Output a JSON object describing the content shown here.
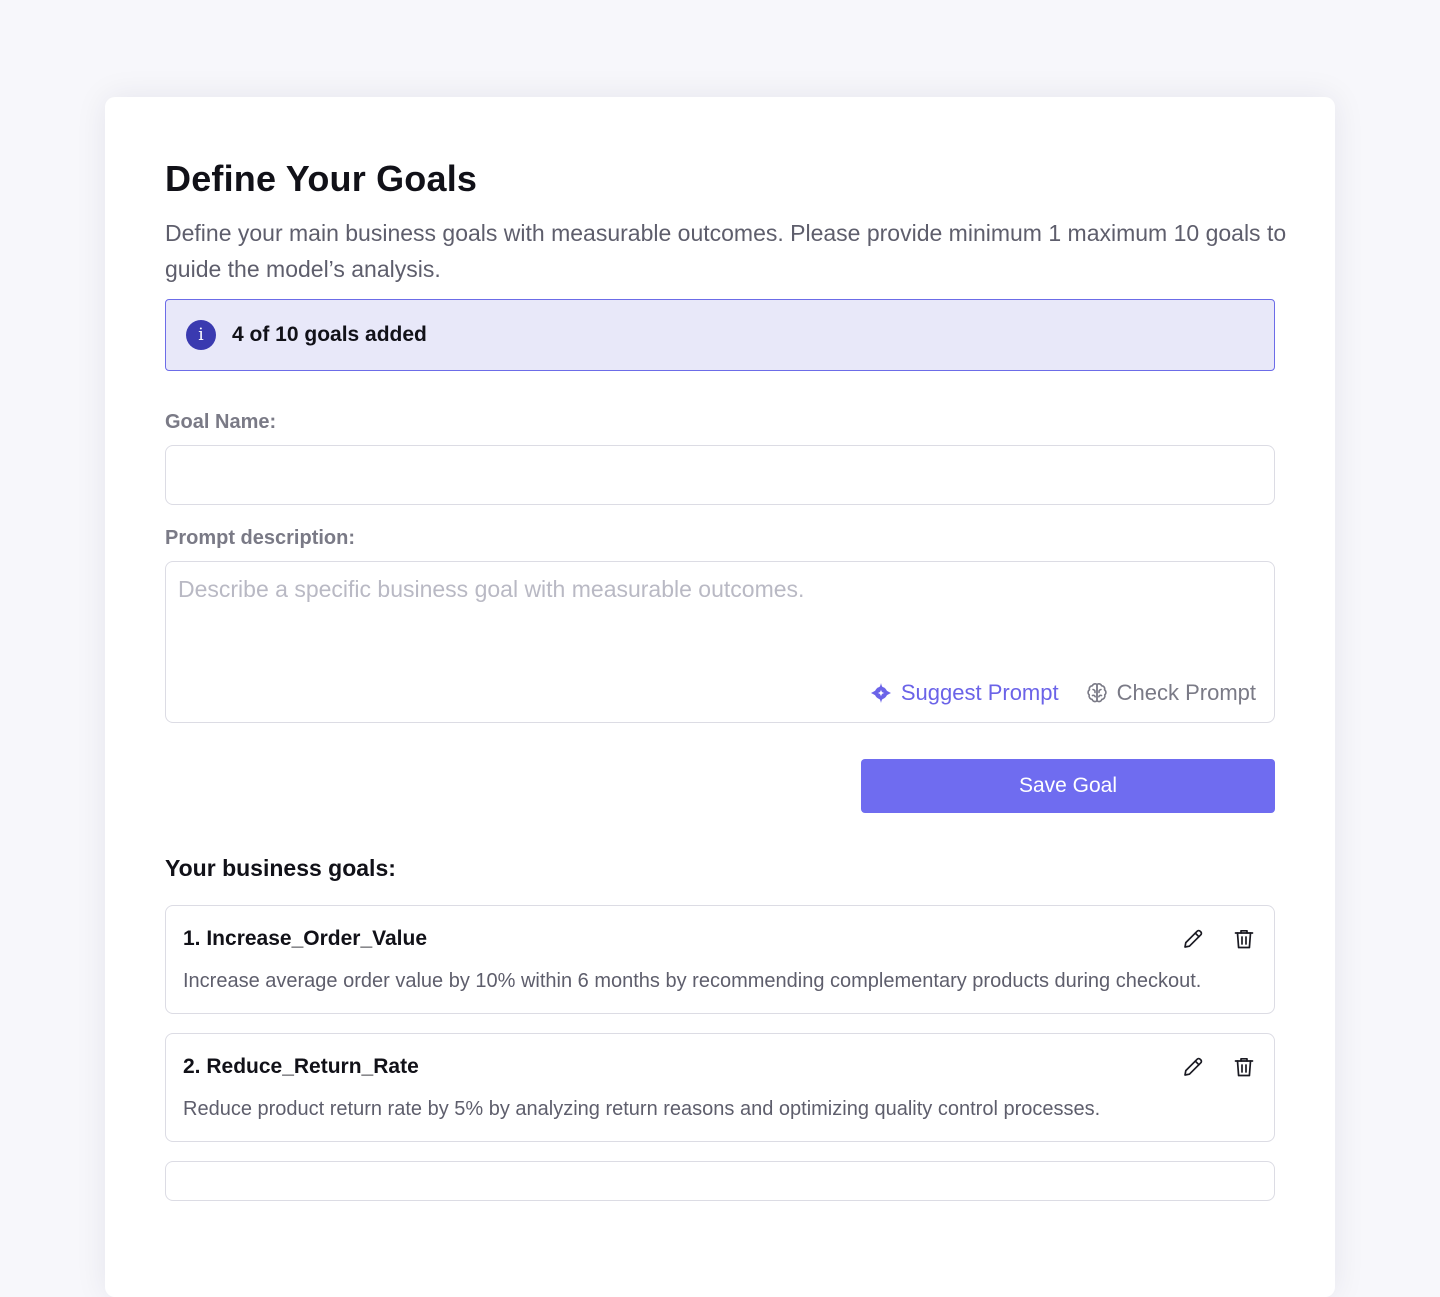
{
  "header": {
    "title": "Define Your Goals",
    "subtitle": "Define your main business goals with measurable outcomes. Please provide minimum 1 maximum 10 goals to guide the model’s analysis."
  },
  "banner": {
    "icon_glyph": "i",
    "text": "4 of 10 goals added"
  },
  "form": {
    "goal_name_label": "Goal Name:",
    "goal_name_value": "",
    "prompt_label": "Prompt description:",
    "prompt_placeholder": "Describe a specific business goal with measurable outcomes.",
    "suggest_label": "Suggest Prompt",
    "check_label": "Check Prompt",
    "save_label": "Save Goal"
  },
  "goals": {
    "heading": "Your business goals:",
    "items": [
      {
        "name": "1. Increase_Order_Value",
        "description": "Increase average order value by 10% within 6 months by recommending complementary products during checkout."
      },
      {
        "name": "2. Reduce_Return_Rate",
        "description": "Reduce product return rate by 5% by analyzing return reasons and optimizing quality control processes."
      }
    ]
  },
  "colors": {
    "accent": "#6f6cf0",
    "banner_bg": "#e8e8f9",
    "banner_border": "#6c6ce8",
    "info_icon": "#3a3ab0"
  }
}
